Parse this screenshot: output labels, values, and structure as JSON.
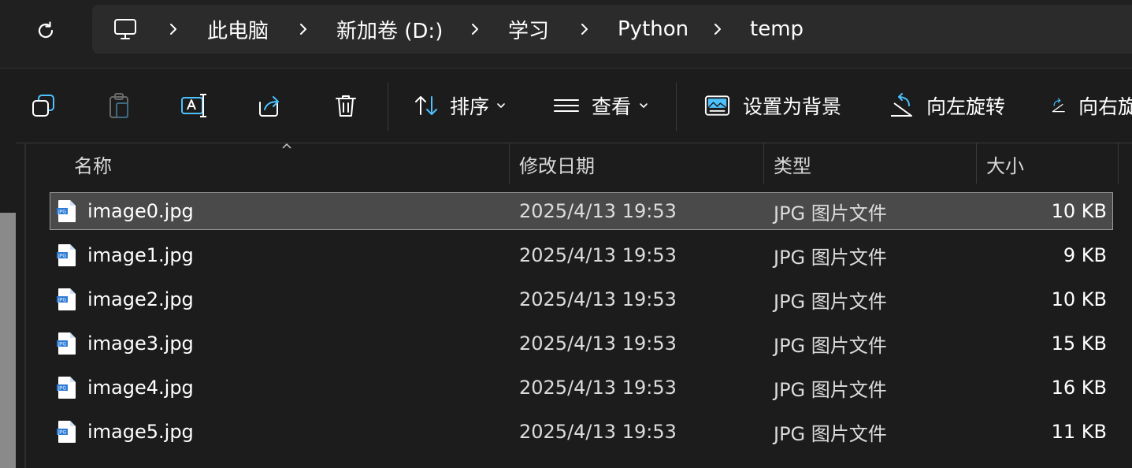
{
  "breadcrumb": {
    "items": [
      "此电脑",
      "新加卷 (D:)",
      "学习",
      "Python",
      "temp"
    ]
  },
  "toolbar": {
    "sort_label": "排序",
    "view_label": "查看",
    "set_background_label": "设置为背景",
    "rotate_left_label": "向左旋转",
    "rotate_right_label": "向右旋"
  },
  "columns": {
    "name": "名称",
    "modified": "修改日期",
    "type": "类型",
    "size": "大小"
  },
  "files": [
    {
      "name": "image0.jpg",
      "modified": "2025/4/13 19:53",
      "type": "JPG 图片文件",
      "size": "10 KB"
    },
    {
      "name": "image1.jpg",
      "modified": "2025/4/13 19:53",
      "type": "JPG 图片文件",
      "size": "9 KB"
    },
    {
      "name": "image2.jpg",
      "modified": "2025/4/13 19:53",
      "type": "JPG 图片文件",
      "size": "10 KB"
    },
    {
      "name": "image3.jpg",
      "modified": "2025/4/13 19:53",
      "type": "JPG 图片文件",
      "size": "15 KB"
    },
    {
      "name": "image4.jpg",
      "modified": "2025/4/13 19:53",
      "type": "JPG 图片文件",
      "size": "16 KB"
    },
    {
      "name": "image5.jpg",
      "modified": "2025/4/13 19:53",
      "type": "JPG 图片文件",
      "size": "11 KB"
    }
  ],
  "file_icon_text": "JPG",
  "colors": {
    "accent": "#4cc2ff",
    "background": "#1c1c1c",
    "selection": "#4a4a4a"
  }
}
